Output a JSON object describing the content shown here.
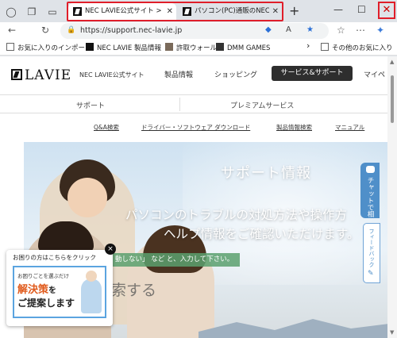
{
  "browser": {
    "tabs": [
      {
        "title": "NEC LAVIE公式サイト > サービ",
        "active": true
      },
      {
        "title": "パソコン(PC)通販のNEC LAVIE",
        "active": false
      }
    ],
    "url": "https://support.nec-lavie.jp",
    "close_symbol": "✕",
    "newtab_symbol": "+"
  },
  "favorites": {
    "items": [
      {
        "label": "お気に入りのインポート"
      },
      {
        "label": "NEC LAVIE 製品情報"
      },
      {
        "label": "許取ウォール"
      },
      {
        "label": "DMM GAMES"
      }
    ],
    "other": "その他のお気に入り",
    "more": "›"
  },
  "site": {
    "logo_text": "LAVIE",
    "site_name": "NEC LAVIE公式サイト",
    "gnav": [
      "製品情報",
      "ショッピング",
      "サービス&サポート",
      "マイペ"
    ],
    "subnav": [
      "サポート",
      "プレミアムサービス"
    ],
    "links": [
      "Q&A検索",
      "ドライバー・ソフトウェア ダウンロード",
      "製品情報検索",
      "マニュアル"
    ]
  },
  "hero": {
    "title": "サポート情報",
    "line1": "パソコンのトラブルの対処方法や操作方",
    "line2": "ヘルプ情報をご確認いただけます。",
    "hint": "動しない」 など と、入力して下さい。",
    "search_fragment": "索する"
  },
  "side": {
    "chat": "チャットで相",
    "feedback": "フィードバック"
  },
  "help": {
    "head": "お困りの方はこちらをクリック",
    "sub": "お困りごとを選ぶだけ",
    "main": "解決策",
    "main_suffix": "を",
    "line2": "ご提案します",
    "close": "×"
  },
  "colors": {
    "highlight": "#e01e2a",
    "accent_blue": "#4f8fc9",
    "active_nav": "#2e2e2e"
  }
}
